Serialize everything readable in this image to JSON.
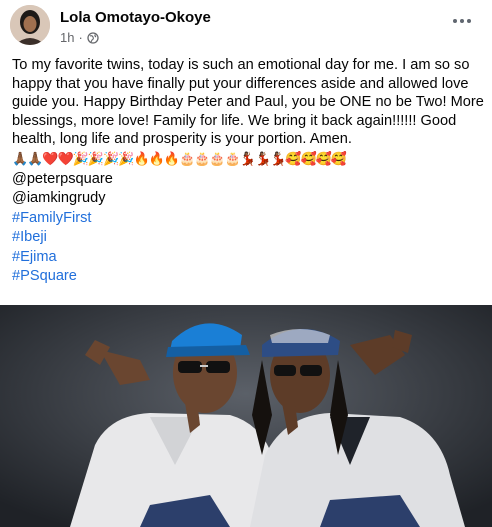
{
  "post": {
    "author": "Lola Omotayo-Okoye",
    "time": "1h",
    "dot": "·",
    "body": "To my favorite twins, today is such an emotional day for me. I am so so happy that you have finally put your differences aside and allowed love guide you. Happy Birthday Peter and Paul, you be ONE no be Two! More blessings, more love! Family for life. We bring it back again!!!!!! Good health, long life and prosperity is your portion. Amen.",
    "emojis": "🙏🏾🙏🏾❤️❤️🎉🎉🎉🎉🔥🔥🔥🎂🎂🎂🎂💃🏾💃🏾💃🏾🥰🥰🥰🥰",
    "mentions": [
      "@peterpsquare",
      "@iamkingrudy"
    ],
    "hashtags": [
      "#FamilyFirst",
      "#Ibeji",
      "#Ejima",
      "#PSquare"
    ]
  },
  "icons": {
    "avatar": "profile-photo",
    "privacy": "globe-icon",
    "more": "more-options-icon"
  },
  "colors": {
    "hashtag": "#216fdb",
    "meta": "#65676b",
    "photo_bg": "#2a2d33",
    "cap_blue": "#1a7fd6"
  }
}
